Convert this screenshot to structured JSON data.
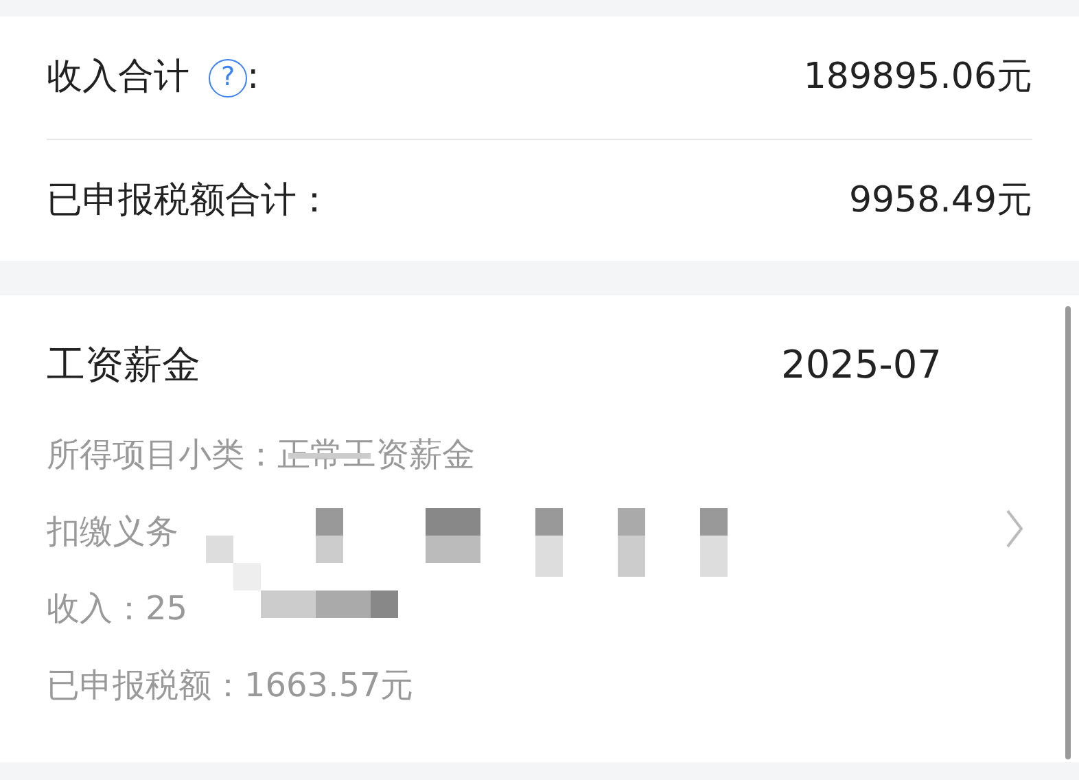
{
  "summary": [
    {
      "label": "收入合计",
      "help": "?",
      "suffix": ":",
      "value": "189895.06元"
    },
    {
      "label": "已申报税额合计：",
      "value": "9958.49元"
    }
  ],
  "record": {
    "title": "工资薪金",
    "period": "2025-07",
    "lines": [
      "所得项目小类：正常工资薪金",
      "扣缴义务",
      "收入：25",
      "已申报税额：1663.57元"
    ],
    "redacted": true
  }
}
